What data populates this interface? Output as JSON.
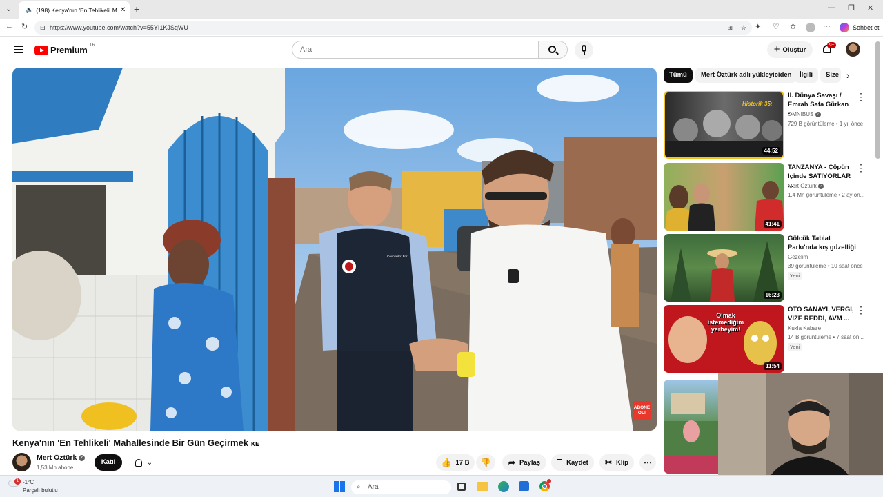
{
  "browser": {
    "tab_title": "(198) Kenya'nın 'En Tehlikeli' M",
    "url": "https://www.youtube.com/watch?v=55YI1KJSqWU",
    "copilot_label": "Sohbet et"
  },
  "header": {
    "logo_text": "Premium",
    "region": "TR",
    "search_placeholder": "Ara",
    "create_label": "Oluştur",
    "notification_count": "9+"
  },
  "video": {
    "title": "Kenya'nın 'En Tehlikeli' Mahallesinde Bir Gün Geçirmek",
    "title_suffix": "ĸᴇ",
    "overlay_subscribe": "ABONE OL!",
    "vest_text": "Counsellor For Religious Affairs in Embassy of Türkiye"
  },
  "channel": {
    "name": "Mert Öztürk",
    "subscribers": "1,53 Mn abone",
    "join_label": "Katıl"
  },
  "actions": {
    "likes": "17 B",
    "share": "Paylaş",
    "save": "Kaydet",
    "clip": "Klip"
  },
  "chips": [
    "Tümü",
    "Mert Öztürk adlı yükleyiciden",
    "İlgili",
    "Size"
  ],
  "suggestions": [
    {
      "title": "II. Dünya Savaşı / Emrah Safa Gürkan -...",
      "channel": "OMNIBUS",
      "meta": "729 B görüntüleme • 1 yıl önce",
      "duration": "44:52",
      "thumb_label": "Historik 35:",
      "badge": ""
    },
    {
      "title": "TANZANYA - Çöpün İçinde SATIYORLAR ...",
      "channel": "Mert Öztürk",
      "meta": "1,4 Mn görüntüleme • 2 ay ön...",
      "duration": "41:41",
      "thumb_label": "",
      "badge": ""
    },
    {
      "title": "Gölcük Tabiat Parkı'nda kış güzelliği",
      "channel": "Gezelim",
      "meta": "39 görüntüleme • 10 saat önce",
      "duration": "16:23",
      "thumb_label": "",
      "badge": "Yeni"
    },
    {
      "title": "OTO SANAYİ, VERGİ, VİZE REDDİ, AVM ...",
      "channel": "Kukla Kabare",
      "meta": "14 B görüntüleme • 7 saat ön...",
      "duration": "11:54",
      "thumb_label": "Olmak istemediğim yerbeyim!",
      "badge": "Yeni"
    }
  ],
  "taskbar": {
    "temperature": "-1°C",
    "weather": "Parçalı bulutlu",
    "search_placeholder": "Ara"
  }
}
